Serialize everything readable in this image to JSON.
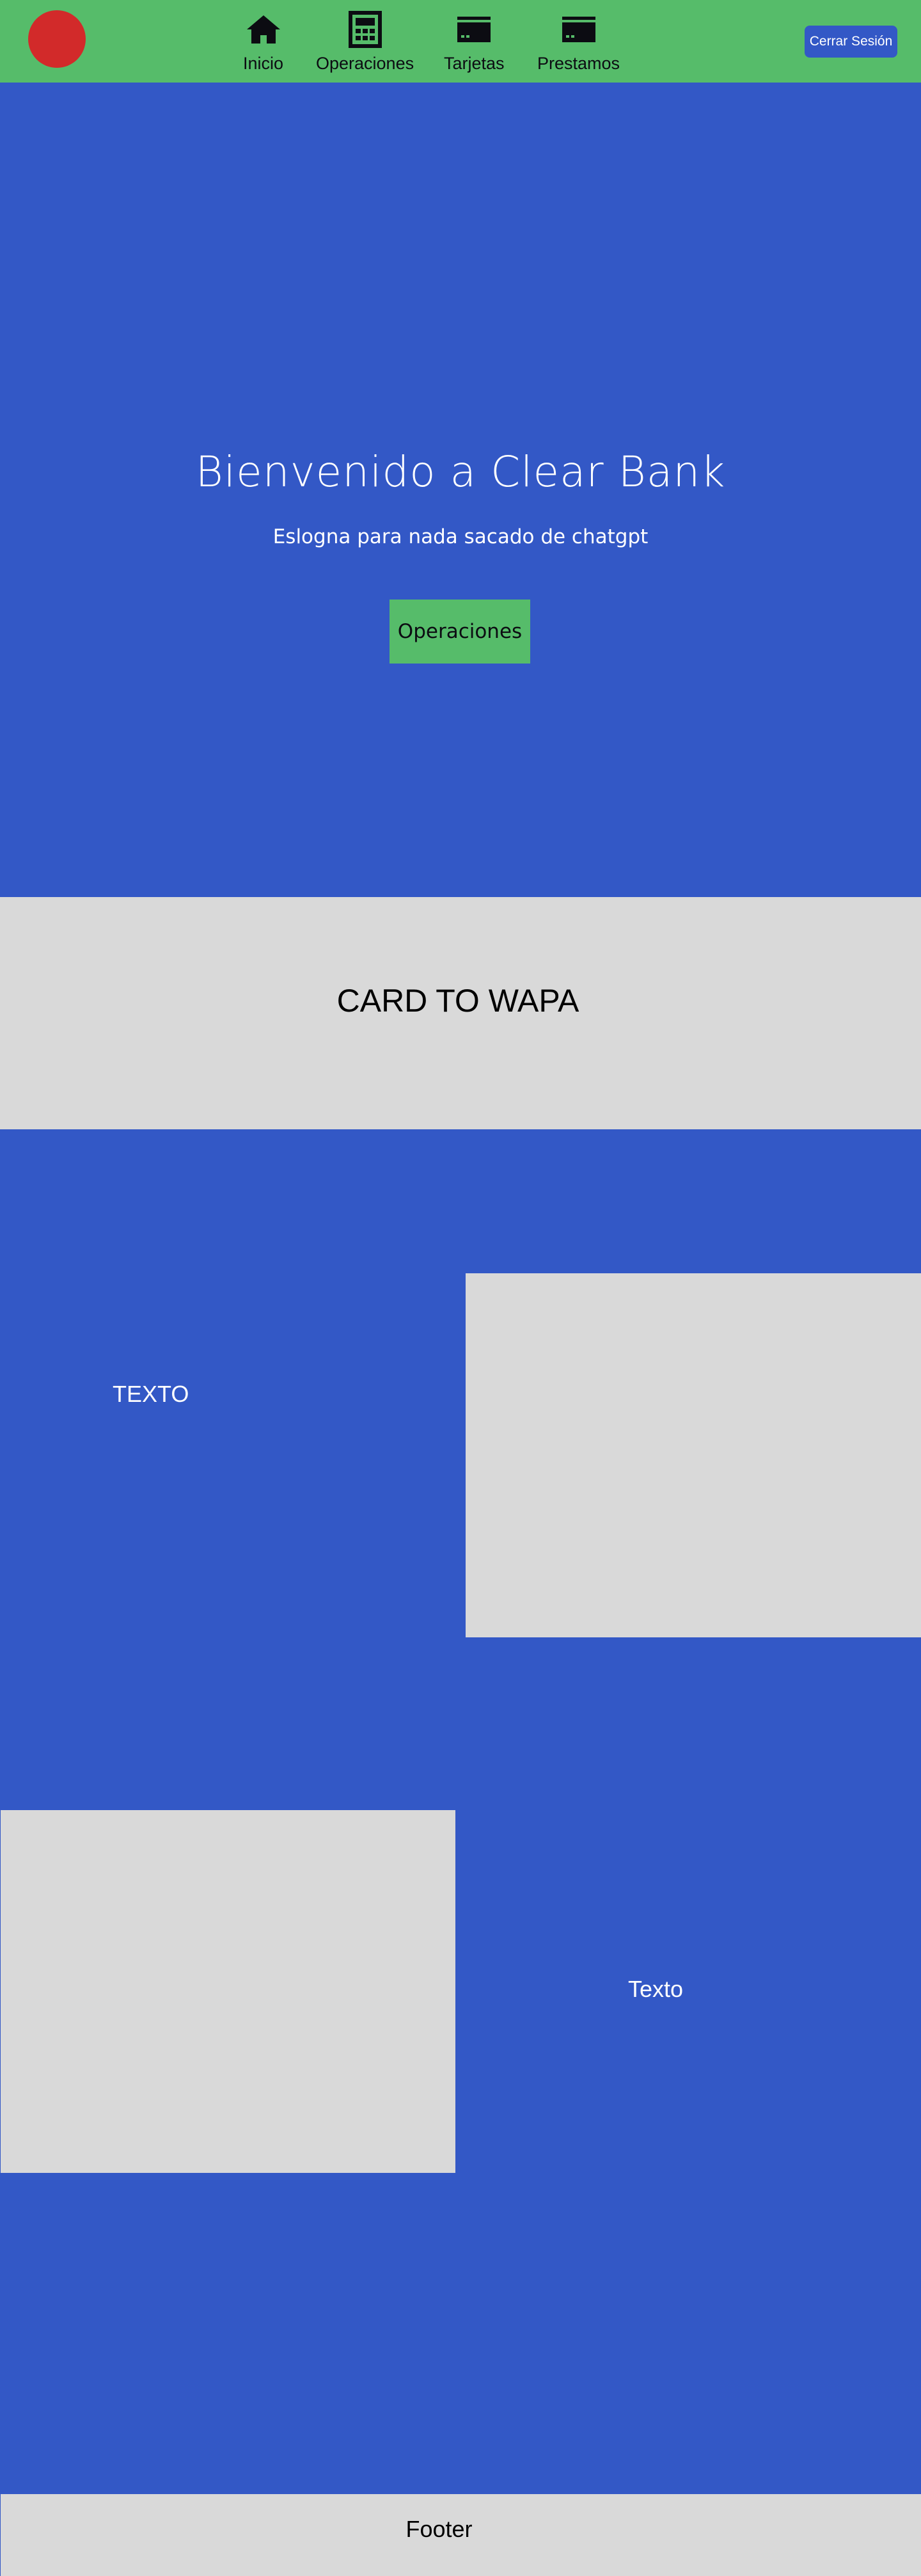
{
  "header": {
    "nav": [
      {
        "label": "Inicio",
        "icon": "home-icon"
      },
      {
        "label": "Operaciones",
        "icon": "calculator-icon"
      },
      {
        "label": "Tarjetas",
        "icon": "credit-card-icon"
      },
      {
        "label": "Prestamos",
        "icon": "credit-card-icon"
      }
    ],
    "logout_label": "Cerrar Sesión"
  },
  "hero": {
    "title": "Bienvenido a Clear Bank",
    "subtitle": "Eslogna para nada sacado de chatgpt",
    "cta_label": "Operaciones"
  },
  "card": {
    "text": "CARD TO WAPA"
  },
  "features": [
    {
      "text": "TEXTO"
    },
    {
      "text": "Texto"
    }
  ],
  "footer": {
    "text": "Footer"
  },
  "colors": {
    "header_bg": "#56bc6a",
    "main_bg": "#3358c6",
    "placeholder_gray": "#d9d9d9",
    "logo": "#d22a2a"
  }
}
